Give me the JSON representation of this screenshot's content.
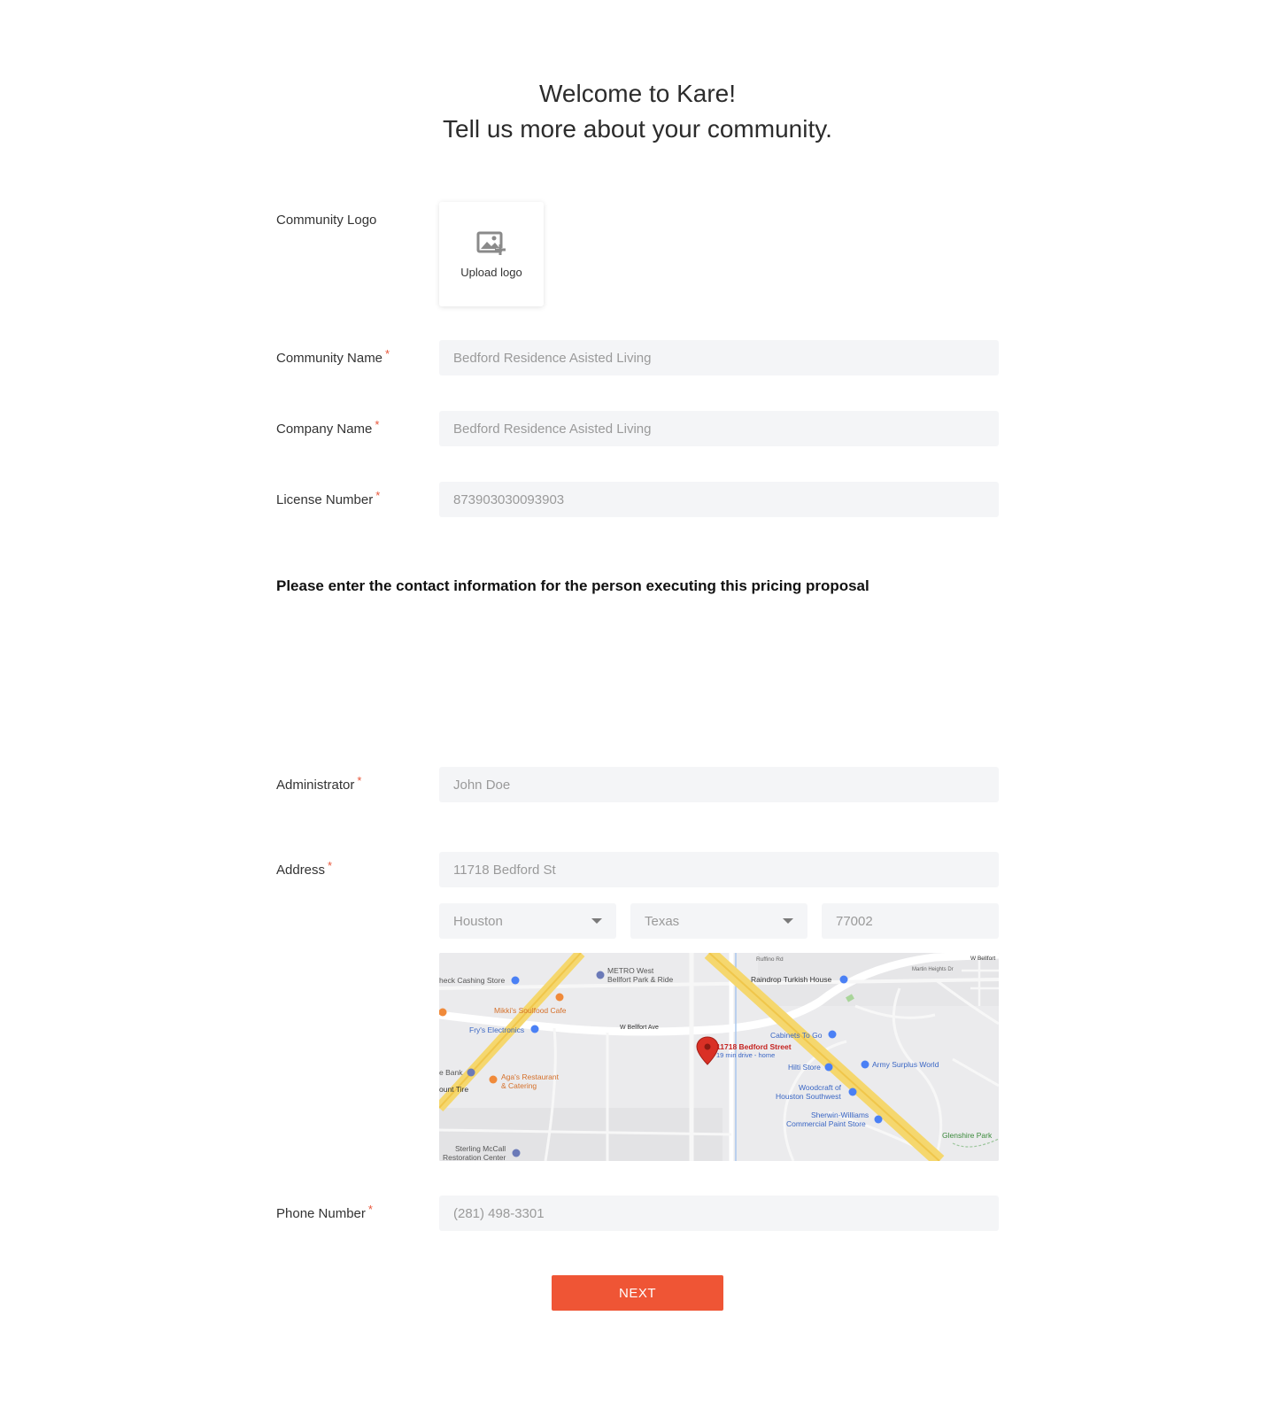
{
  "header": {
    "title_line1": "Welcome to Kare!",
    "title_line2": "Tell us more about your community."
  },
  "form": {
    "logo": {
      "label": "Community Logo",
      "upload_label": "Upload logo"
    },
    "community_name": {
      "label": "Community Name",
      "placeholder": "Bedford Residence Asisted Living"
    },
    "company_name": {
      "label": "Company Name",
      "placeholder": "Bedford Residence Asisted Living"
    },
    "license_number": {
      "label": "License Number",
      "placeholder": "873903030093903"
    },
    "contact_note": "Please enter the contact information for the person executing this pricing proposal",
    "administrator": {
      "label": "Administrator",
      "placeholder": "John Doe"
    },
    "address": {
      "label": "Address",
      "street_placeholder": "11718 Bedford St",
      "city": "Houston",
      "state": "Texas",
      "zip_placeholder": "77002"
    },
    "phone": {
      "label": "Phone Number",
      "placeholder": "(281) 498-3301"
    },
    "required_mark": "*"
  },
  "map": {
    "pin_title": "11718 Bedford Street",
    "pin_subtitle": "19 min drive - home",
    "places": [
      "heck Cashing Store",
      "METRO West",
      "Bellfort Park & Ride",
      "Mikki's Soulfood Cafe",
      "Fry's Electronics",
      "W Bellfort Ave",
      "e Bank",
      "ount Tire",
      "Aga's Restaurant",
      "& Catering",
      "Raindrop Turkish House",
      "Cabinets To Go",
      "Hilti Store",
      "Army Surplus World",
      "Woodcraft of",
      "Houston Southwest",
      "Sherwin-Williams",
      "Commercial Paint Store",
      "Sterling McCall",
      "Restoration Center",
      "Glenshire Park",
      "Ruffino Rd",
      "W Bellfort",
      "Martin Heights Dr"
    ],
    "colors": {
      "pin": "#d93025",
      "highway": "#f5d76e",
      "poi_blue": "#4a80f5",
      "poi_orange": "#f08a3a"
    }
  },
  "actions": {
    "next_label": "NEXT"
  },
  "theme": {
    "accent": "#ef5535",
    "field_bg": "#f4f5f7",
    "required": "#e8563a"
  }
}
